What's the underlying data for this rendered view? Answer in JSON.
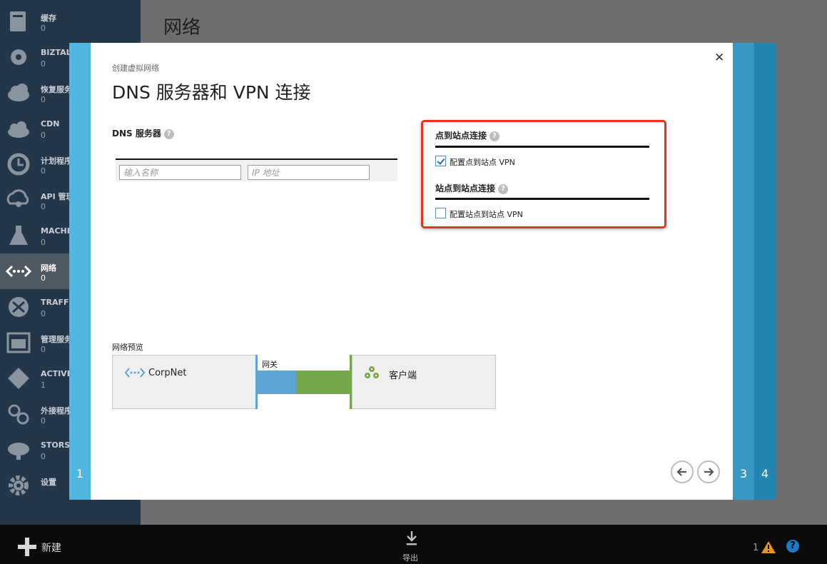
{
  "page": {
    "title": "网络"
  },
  "sidebar": {
    "items": [
      {
        "label": "缓存",
        "count": "0",
        "icon": "cache-icon"
      },
      {
        "label": "BIZTALK",
        "count": "0",
        "icon": "biztalk-icon"
      },
      {
        "label": "恢复服务",
        "count": "0",
        "icon": "recovery-icon"
      },
      {
        "label": "CDN",
        "count": "0",
        "icon": "cdn-icon"
      },
      {
        "label": "计划程序",
        "count": "0",
        "icon": "scheduler-icon"
      },
      {
        "label": "API 管理",
        "count": "0",
        "icon": "api-icon"
      },
      {
        "label": "MACHINE",
        "count": "0",
        "icon": "machine-learning-icon"
      },
      {
        "label": "网络",
        "count": "0",
        "icon": "network-icon"
      },
      {
        "label": "TRAFFIC",
        "count": "0",
        "icon": "traffic-manager-icon"
      },
      {
        "label": "管理服务",
        "count": "0",
        "icon": "management-icon"
      },
      {
        "label": "ACTIVE",
        "count": "1",
        "icon": "active-directory-icon"
      },
      {
        "label": "外接程序",
        "count": "0",
        "icon": "addons-icon"
      },
      {
        "label": "STORSIMPLE",
        "count": "0",
        "icon": "storsimple-icon"
      },
      {
        "label": "设置",
        "count": "",
        "icon": "settings-icon"
      }
    ]
  },
  "wizard": {
    "subtitle": "创建虚拟网络",
    "title": "DNS 服务器和 VPN 连接",
    "steps": {
      "first": "1",
      "third": "3",
      "fourth": "4"
    },
    "dns": {
      "label": "DNS 服务器",
      "name_placeholder": "输入名称",
      "ip_placeholder": "IP 地址"
    },
    "vpn": {
      "p2s_heading": "点到站点连接",
      "p2s_checkbox": "配置点到站点 VPN",
      "p2s_checked": true,
      "s2s_heading": "站点到站点连接",
      "s2s_checkbox": "配置站点到站点 VPN",
      "s2s_checked": false
    },
    "preview": {
      "label": "网络预览",
      "network": "CorpNet",
      "gateway": "网关",
      "client": "客户端"
    }
  },
  "bottom": {
    "new_label": "新建",
    "export_label": "导出",
    "alert_count": "1"
  },
  "colors": {
    "accent_blue": "#5ba3d5",
    "accent_green": "#77a64a",
    "highlight_red": "#e8341c",
    "sidebar_bg": "#23364a"
  }
}
